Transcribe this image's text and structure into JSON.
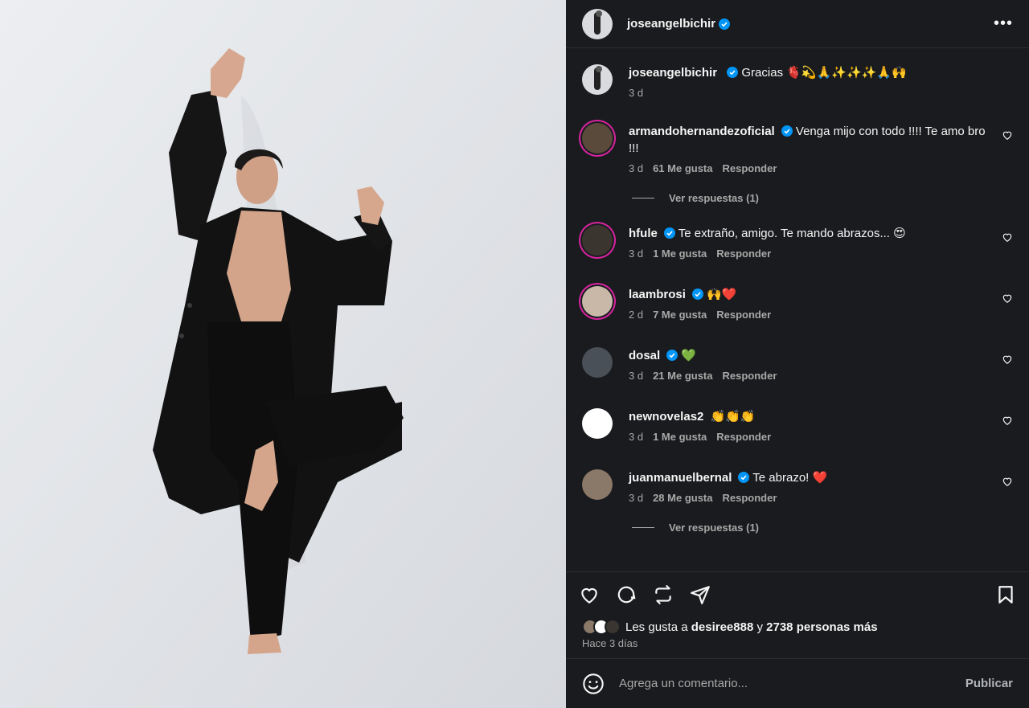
{
  "post_author": {
    "username": "joseangelbichir",
    "verified": true,
    "more_icon": "more-horizontal-icon"
  },
  "caption": {
    "username": "joseangelbichir",
    "text": "Gracias 🫀💫🙏✨✨✨🙏🙌",
    "time": "3 d"
  },
  "comments": [
    {
      "username": "armandohernandezoficial",
      "text": "Venga mijo con todo !!!! Te amo bro !!!",
      "time": "3 d",
      "likes": "61 Me gusta",
      "reply": "Responder",
      "replies": "Ver respuestas (1)"
    },
    {
      "username": "hfule",
      "text": "Te extraño, amigo. Te mando abrazos... 😍",
      "time": "3 d",
      "likes": "1 Me gusta",
      "reply": "Responder"
    },
    {
      "username": "laambrosi",
      "text": "🙌❤️",
      "time": "2 d",
      "likes": "7 Me gusta",
      "reply": "Responder"
    },
    {
      "username": "dosal",
      "text": "💚",
      "time": "3 d",
      "likes": "21 Me gusta",
      "reply": "Responder"
    },
    {
      "username": "newnovelas2",
      "text": "👏👏👏",
      "time": "3 d",
      "likes": "1 Me gusta",
      "reply": "Responder"
    },
    {
      "username": "juanmanuelbernal",
      "text": "Te abrazo! ❤️",
      "time": "3 d",
      "likes": "28 Me gusta",
      "reply": "Responder",
      "replies": "Ver respuestas (1)"
    }
  ],
  "likes_summary": {
    "prefix": "Les gusta a",
    "user": "desiree888",
    "connector": "y",
    "others": "2738 personas más"
  },
  "time_ago": "Hace 3 días",
  "composer": {
    "placeholder": "Agrega un comentario...",
    "publish_label": "Publicar"
  },
  "colors": {
    "panel_bg": "#1a1b1e",
    "verified_blue": "#0095f6",
    "muted_text": "#a8a8a8"
  }
}
